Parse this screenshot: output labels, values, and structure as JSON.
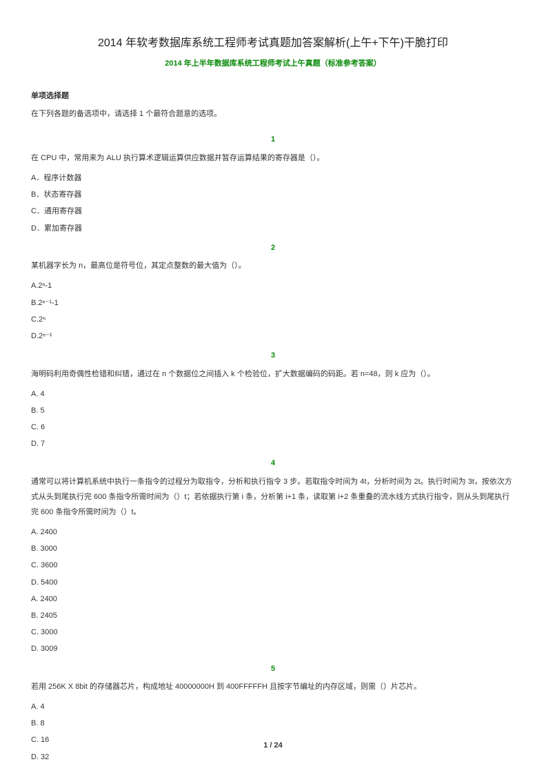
{
  "title": "2014 年软考数据库系统工程师考试真题加答案解析(上午+下午)干脆打印",
  "subtitle": "2014 年上半年数据库系统工程师考试上午真题（标准参考答案）",
  "section_header": "单项选择题",
  "instruction": "在下列各题的备选项中，请选择 1 个最符合题意的选项。",
  "questions": [
    {
      "number": "1",
      "text": "在 CPU 中，常用来为 ALU 执行算术逻辑运算供应数据并暂存运算结果的寄存器是（）。",
      "options": [
        "A．程序计数器",
        "B．状态寄存器",
        "C．通用寄存器",
        "D．累加寄存器"
      ]
    },
    {
      "number": "2",
      "text": "某机器字长为 n，最高位是符号位，其定点整数的最大值为（）。",
      "options": [
        "A.2ⁿ-1",
        "B.2ⁿ⁻¹-1",
        "C.2ⁿ",
        "D.2ⁿ⁻¹"
      ]
    },
    {
      "number": "3",
      "text": "海明码利用奇偶性检错和纠错，通过在 n 个数据位之间插入 k 个检验位，扩大数据编码的码距。若 n=48，则 k 应为（）。",
      "options": [
        "A. 4",
        "B. 5",
        "C. 6",
        "D. 7"
      ]
    },
    {
      "number": "4",
      "text": "通常可以将计算机系统中执行一条指令的过程分为取指令，分析和执行指令 3 步。若取指令时间为 4t，分析时间为 2t。执行时间为 3t，按依次方式从头到尾执行完 600 条指令所需时间为（）t；若依据执行第 i 条，分析第 i+1 条，读取第 i+2 条重叠的流水线方式执行指令，则从头到尾执行完 600 条指令所需时间为（）t。",
      "options": [
        "A. 2400",
        "B. 3000",
        "C. 3600",
        "D. 5400",
        "A. 2400",
        "B. 2405",
        "C. 3000",
        "D. 3009"
      ]
    },
    {
      "number": "5",
      "text": "若用 256K X 8bit 的存储器芯片，构成地址 40000000H 到 400FFFFFH 且按字节编址的内存区域，则需（）片芯片。",
      "options": [
        "A. 4",
        "B. 8",
        "C. 16",
        "D. 32"
      ]
    }
  ],
  "page_current": "1",
  "page_total": "24"
}
